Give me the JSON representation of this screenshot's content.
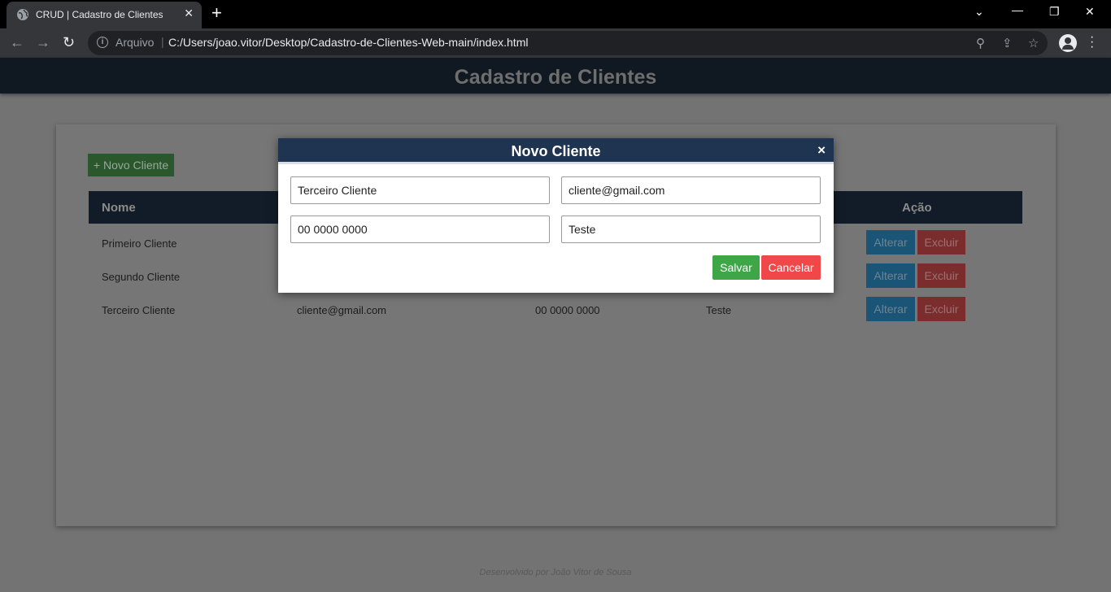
{
  "browser": {
    "tab_title": "CRUD | Cadastro de Clientes",
    "tab_close": "✕",
    "new_tab": "+",
    "address_scheme": "Arquivo",
    "address_url": "C:/Users/joao.vitor/Desktop/Cadastro-de-Clientes-Web-main/index.html"
  },
  "header": {
    "title": "Cadastro de Clientes"
  },
  "toolbar": {
    "new_client_label": "+ Novo Cliente"
  },
  "table": {
    "headers": {
      "name": "Nome",
      "action": "Ação"
    },
    "rows": [
      {
        "name": "Primeiro Cliente",
        "email": "",
        "phone": "",
        "city": ""
      },
      {
        "name": "Segundo Cliente",
        "email": "",
        "phone": "",
        "city": ""
      },
      {
        "name": "Terceiro Cliente",
        "email": "cliente@gmail.com",
        "phone": "00 0000 0000",
        "city": "Teste"
      }
    ],
    "edit_label": "Alterar",
    "delete_label": "Excluir"
  },
  "modal": {
    "title": "Novo Cliente",
    "close": "×",
    "fields": {
      "name": "Terceiro Cliente",
      "email": "cliente@gmail.com",
      "phone": "00 0000 0000",
      "city": "Teste"
    },
    "save_label": "Salvar",
    "cancel_label": "Cancelar"
  },
  "footer": {
    "text": "Desenvolvido por João Vitor de Sousa"
  },
  "colors": {
    "header_bg": "#101821",
    "modal_header_bg": "#1f3450",
    "save_green": "#3fa648",
    "cancel_red": "#f04848",
    "edit_blue": "#1a5476",
    "new_green": "#2a582c"
  }
}
